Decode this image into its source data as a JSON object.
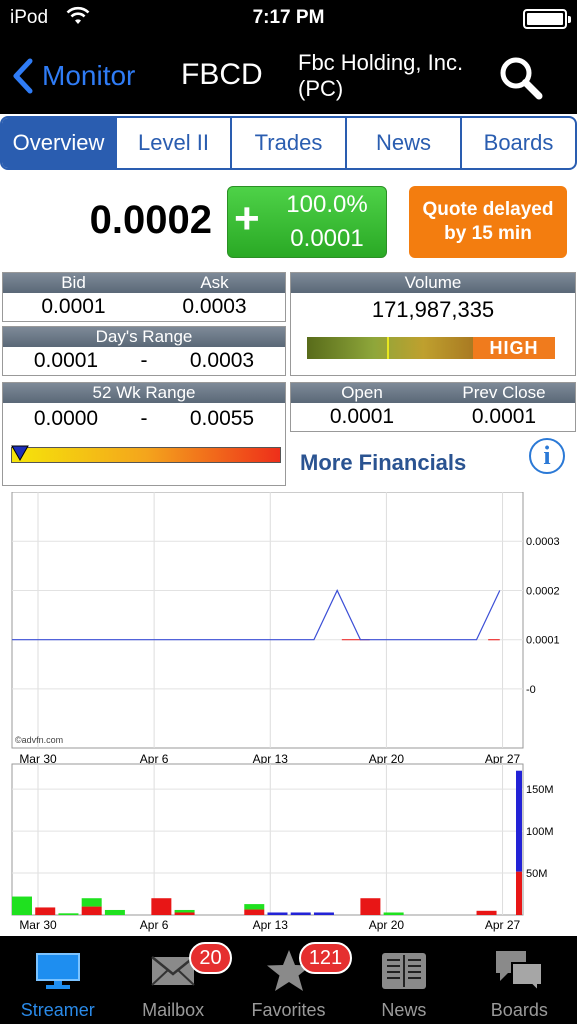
{
  "status_bar": {
    "carrier": "iPod",
    "time": "7:17 PM"
  },
  "nav": {
    "back_label": "Monitor",
    "symbol": "FBCD",
    "company": "Fbc Holding, Inc. (PC)"
  },
  "tabs": [
    {
      "label": "Overview",
      "active": true
    },
    {
      "label": "Level II",
      "active": false
    },
    {
      "label": "Trades",
      "active": false
    },
    {
      "label": "News",
      "active": false
    },
    {
      "label": "Boards",
      "active": false
    }
  ],
  "quote": {
    "price": "0.0002",
    "change_sign": "+",
    "change_pct": "100.0%",
    "change_abs": "0.0001",
    "delayed_text": [
      "Quote delayed",
      "by 15 min"
    ]
  },
  "bid_ask": {
    "bid_label": "Bid",
    "ask_label": "Ask",
    "bid": "0.0001",
    "ask": "0.0003"
  },
  "days_range": {
    "label": "Day's Range",
    "low": "0.0001",
    "sep": "-",
    "high": "0.0003"
  },
  "wk52_range": {
    "label": "52 Wk Range",
    "low": "0.0000",
    "sep": "-",
    "high": "0.0055",
    "position": 0.0
  },
  "volume": {
    "label": "Volume",
    "value": "171,987,335",
    "level_label": "HIGH"
  },
  "open_close": {
    "open_label": "Open",
    "prev_label": "Prev Close",
    "open": "0.0001",
    "prev": "0.0001"
  },
  "links": {
    "more_financials": "More Financials"
  },
  "colors": {
    "accent_blue": "#2a5db0",
    "up_green": "#3bbf36",
    "delayed_orange": "#f37d0f",
    "vol_up": "#1fe11f",
    "vol_down": "#e81616",
    "vol_neutral": "#2323d6"
  },
  "chart_data": {
    "type": "line",
    "watermark": "©advfn.com",
    "x_tick_labels": [
      "Mar 30",
      "Apr 6",
      "Apr 13",
      "Apr 20",
      "Apr 27"
    ],
    "price": {
      "y_tick_labels": [
        "0.0003",
        "0.0002",
        "0.0001",
        "-0"
      ],
      "y_ticks": [
        0.0003,
        0.0002,
        0.0001,
        0
      ],
      "ylim": [
        -0.00012,
        0.0004
      ],
      "x": [
        0,
        13,
        14,
        15,
        18,
        20,
        21
      ],
      "values": [
        0.0001,
        0.0001,
        0.0002,
        0.0001,
        0.0001,
        0.0001,
        0.0002
      ]
    },
    "volume": {
      "y_tick_labels": [
        "150M",
        "100M",
        "50M"
      ],
      "y_ticks": [
        150,
        100,
        50
      ],
      "ylim": [
        0,
        180
      ],
      "unit": "M",
      "bars": [
        {
          "x": 0,
          "value": 22,
          "color": "up"
        },
        {
          "x": 1,
          "value": 9,
          "color": "down"
        },
        {
          "x": 2,
          "value": 2,
          "color": "up"
        },
        {
          "x": 3,
          "value": 20,
          "color": "split"
        },
        {
          "x": 4,
          "value": 6,
          "color": "up"
        },
        {
          "x": 6,
          "value": 20,
          "color": "down"
        },
        {
          "x": 7,
          "value": 6,
          "color": "split"
        },
        {
          "x": 10,
          "value": 13,
          "color": "split"
        },
        {
          "x": 11,
          "value": 3,
          "color": "neutral"
        },
        {
          "x": 12,
          "value": 3,
          "color": "neutral"
        },
        {
          "x": 13,
          "value": 3,
          "color": "neutral"
        },
        {
          "x": 15,
          "value": 20,
          "color": "down"
        },
        {
          "x": 16,
          "value": 3,
          "color": "up"
        },
        {
          "x": 20,
          "value": 5,
          "color": "down"
        },
        {
          "x": 21,
          "value": 172,
          "color": "split_big"
        }
      ]
    }
  },
  "tabbar": [
    {
      "label": "Streamer",
      "icon": "monitor-icon",
      "active": true,
      "badge": ""
    },
    {
      "label": "Mailbox",
      "icon": "envelope-icon",
      "active": false,
      "badge": "20"
    },
    {
      "label": "Favorites",
      "icon": "star-icon",
      "active": false,
      "badge": "121"
    },
    {
      "label": "News",
      "icon": "newspaper-icon",
      "active": false,
      "badge": ""
    },
    {
      "label": "Boards",
      "icon": "chat-bubbles-icon",
      "active": false,
      "badge": ""
    }
  ]
}
